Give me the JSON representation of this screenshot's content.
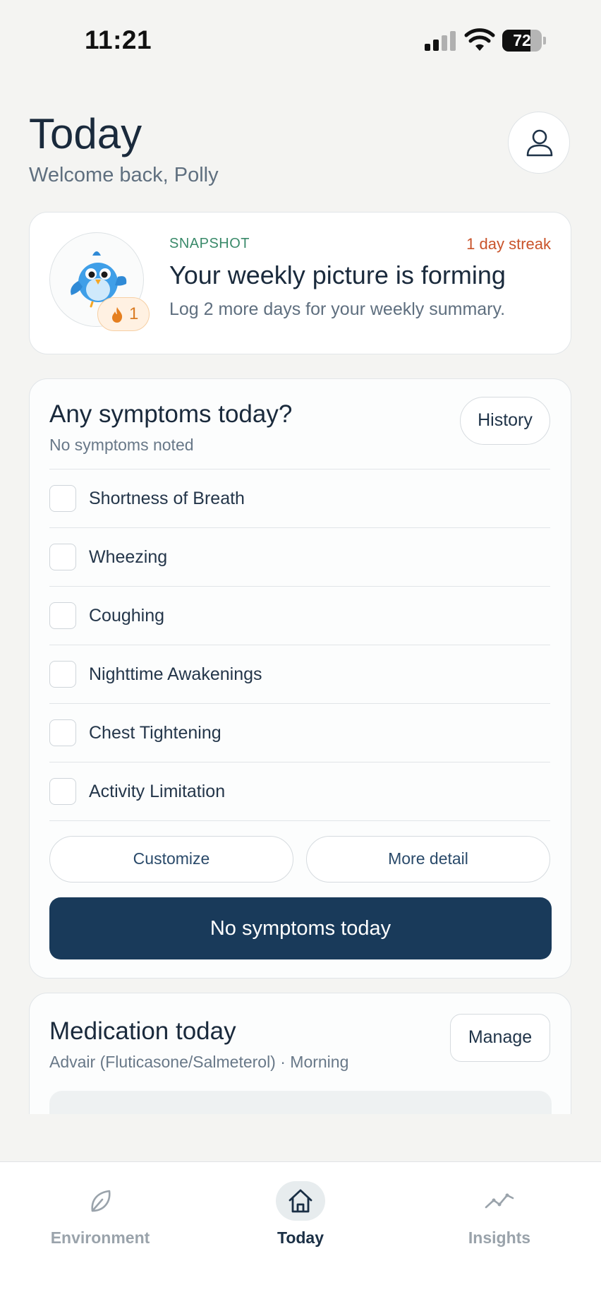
{
  "status_bar": {
    "time": "11:21",
    "battery": "72",
    "battery_level": 0.72
  },
  "header": {
    "title": "Today",
    "subtitle": "Welcome back, Polly"
  },
  "snapshot": {
    "label": "SNAPSHOT",
    "streak": "1 day streak",
    "title": "Your weekly picture is forming",
    "subtitle": "Log 2 more days for your weekly summary.",
    "badge_count": "1"
  },
  "symptoms": {
    "title": "Any symptoms today?",
    "subtitle": "No symptoms noted",
    "history_label": "History",
    "items": [
      {
        "label": "Shortness of Breath",
        "checked": false
      },
      {
        "label": "Wheezing",
        "checked": false
      },
      {
        "label": "Coughing",
        "checked": false
      },
      {
        "label": "Nighttime Awakenings",
        "checked": false
      },
      {
        "label": "Chest Tightening",
        "checked": false
      },
      {
        "label": "Activity Limitation",
        "checked": false
      }
    ],
    "customize_label": "Customize",
    "more_detail_label": "More detail",
    "no_symptoms_label": "No symptoms today"
  },
  "medication": {
    "title": "Medication today",
    "subtitle": "Advair (Fluticasone/Salmeterol) · Morning",
    "manage_label": "Manage"
  },
  "tabs": [
    {
      "label": "Environment",
      "icon": "leaf-icon",
      "active": false
    },
    {
      "label": "Today",
      "icon": "home-icon",
      "active": true
    },
    {
      "label": "Insights",
      "icon": "trend-line-icon",
      "active": false
    }
  ],
  "colors": {
    "primary": "#193a5a",
    "accent_green": "#3a8a6a",
    "streak": "#c9532a",
    "background": "#f4f4f2"
  }
}
